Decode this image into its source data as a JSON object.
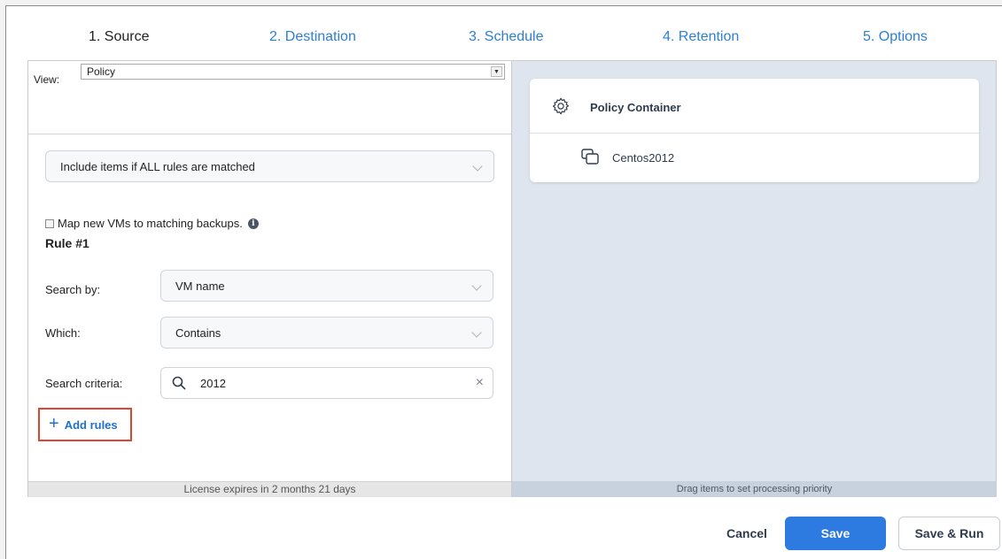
{
  "tabs": [
    {
      "label": "1. Source"
    },
    {
      "label": "2. Destination"
    },
    {
      "label": "3. Schedule"
    },
    {
      "label": "4. Retention"
    },
    {
      "label": "5. Options"
    }
  ],
  "left_panel": {
    "view_label": "View:",
    "view_value": "Policy",
    "match_rule": "Include items if ALL rules are matched",
    "map_checkbox_label": "Map new VMs to matching backups.",
    "map_checkbox_checked": false,
    "rule_title": "Rule #1",
    "search_by_label": "Search by:",
    "search_by_value": "VM name",
    "which_label": "Which:",
    "which_value": "Contains",
    "criteria_label": "Search criteria:",
    "criteria_value": "2012",
    "add_rules": "Add rules",
    "license_text": "License expires in 2 months 21 days"
  },
  "right_panel": {
    "container_title": "Policy Container",
    "items": [
      "Centos2012"
    ],
    "footer_text": "Drag items to set processing priority"
  },
  "buttons": {
    "cancel": "Cancel",
    "save": "Save",
    "save_run": "Save & Run"
  },
  "colors": {
    "accent": "#2d7be0",
    "link": "#2d7fd3",
    "highlight_border": "#e0432e",
    "right_panel_bg": "#dfe5ee"
  }
}
